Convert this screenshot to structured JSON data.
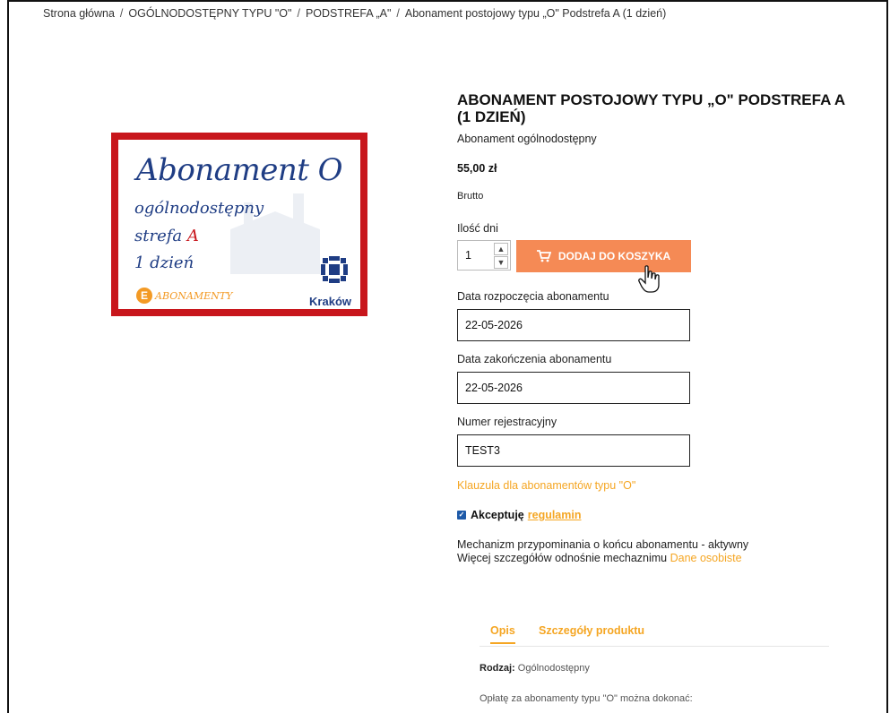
{
  "breadcrumb": {
    "items": [
      "Strona główna",
      "OGÓLNODOSTĘPNY TYPU \"O\"",
      "PODSTREFA „A\"",
      "Abonament postojowy typu „O\" Podstrefa A (1 dzień)"
    ],
    "separator": "/"
  },
  "image": {
    "title": "Abonament O",
    "line1": "ogólnodostępny",
    "line2_prefix": "strefa ",
    "line2_zone": "A",
    "line3": "1 dzień",
    "badge_letter": "E",
    "badge_text": "ABONAMENTY",
    "city": "Kraków",
    "border_color": "#c8161c",
    "text_color": "#1f3d84"
  },
  "product": {
    "title": "ABONAMENT POSTOJOWY TYPU „O\" PODSTREFA A (1 DZIEŃ)",
    "subtitle": "Abonament ogólnodostępny",
    "price": "55,00 zł",
    "tax_label": "Brutto"
  },
  "quantity": {
    "label": "Ilość dni",
    "value": "1"
  },
  "add_to_cart": {
    "label": "DODAJ DO KOSZYKA",
    "icon": "cart-icon",
    "color": "#f58a55"
  },
  "fields": {
    "start_label": "Data rozpoczęcia abonamentu",
    "start_value": "22-05-2026",
    "end_label": "Data zakończenia abonamentu",
    "end_value": "22-05-2026",
    "plate_label": "Numer rejestracyjny",
    "plate_value": "TEST3"
  },
  "clause_link": "Klauzula dla abonamentów typu \"O\"",
  "terms": {
    "checked": true,
    "label": "Akceptuję",
    "link": "regulamin"
  },
  "reminder": {
    "line1": "Mechanizm przypominania o końcu abonamentu - aktywny",
    "line2": "Więcej szczegółów odnośnie mechaznimu",
    "link": "Dane osobiste"
  },
  "tabs": [
    {
      "label": "Opis",
      "active": true
    },
    {
      "label": "Szczegóły produktu",
      "active": false
    }
  ],
  "description": {
    "kind_label": "Rodzaj:",
    "kind_value": "Ogólnodostępny",
    "payment_text": "Opłatę za abonamenty typu \"O\" można dokonać:"
  },
  "accent_color": "#f5a623"
}
